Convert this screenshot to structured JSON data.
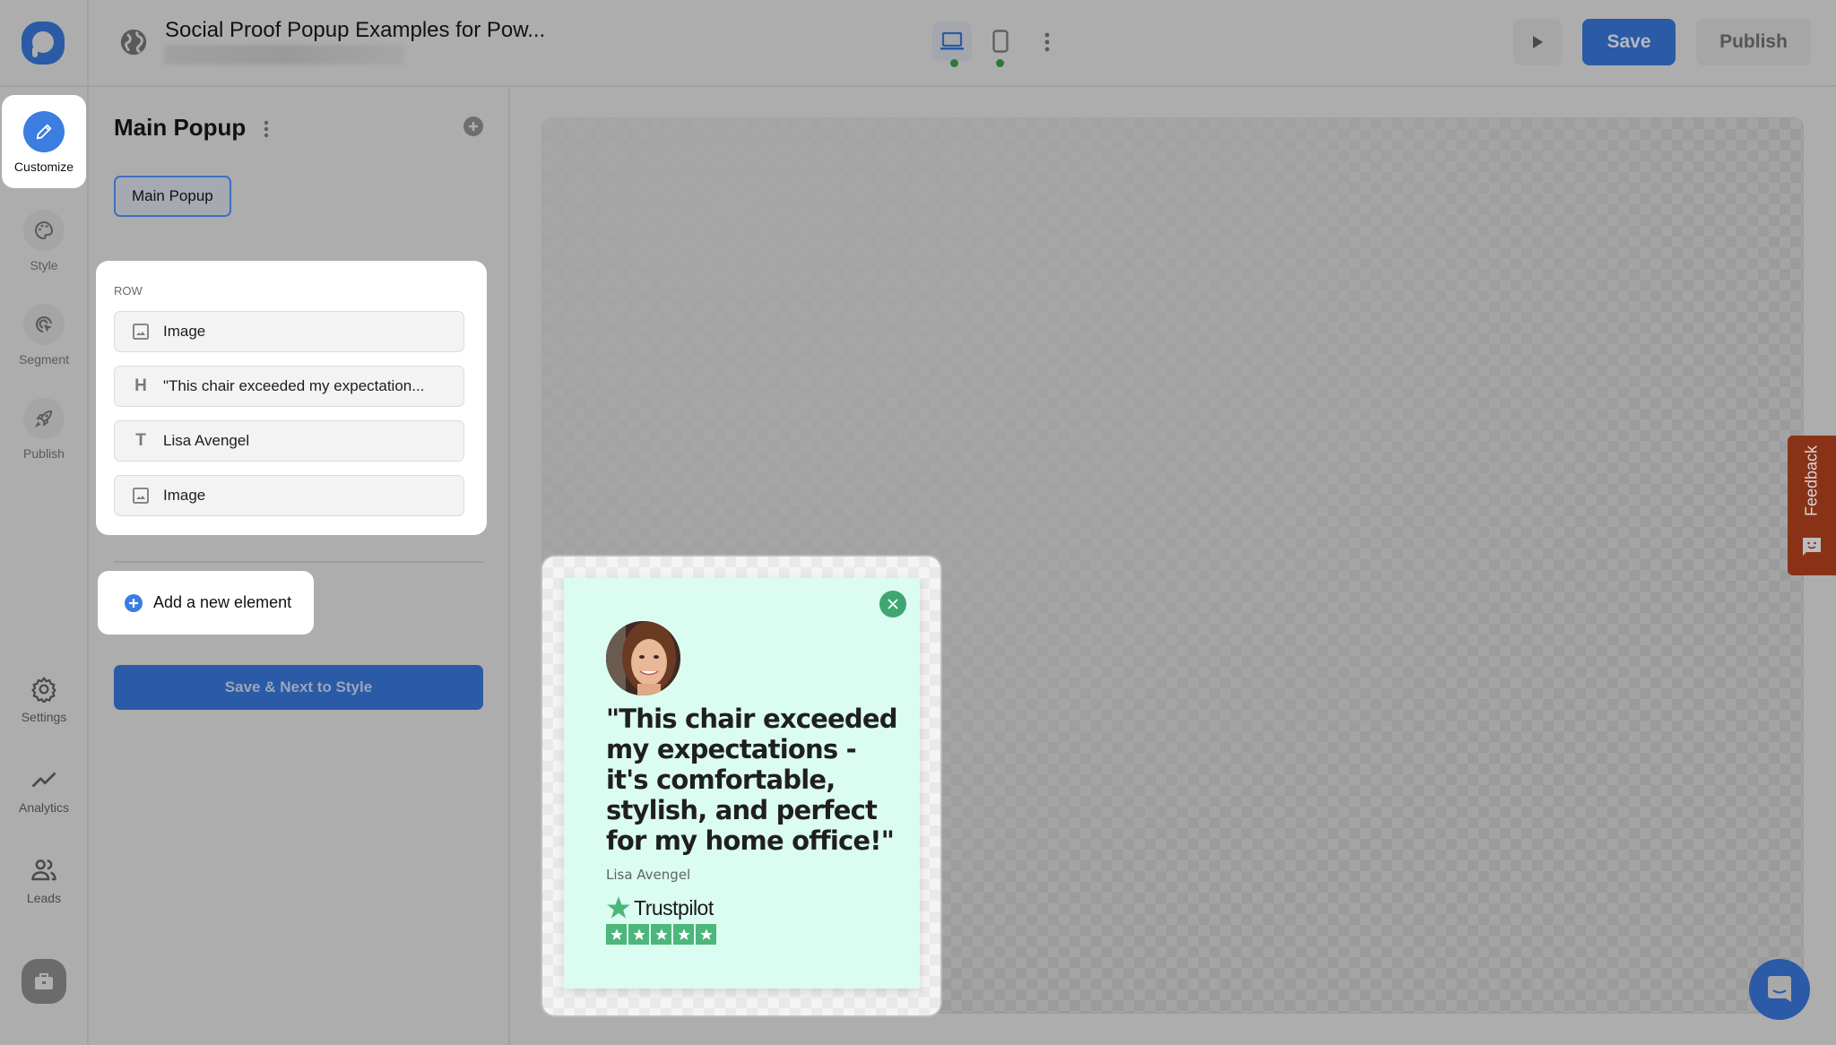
{
  "app": {
    "logo": "popupsmart-logo",
    "document_title": "Social Proof Popup Examples for Pow...",
    "document_subtitle_blurred": true
  },
  "topbar": {
    "globe_icon": "globe-icon",
    "devices": [
      {
        "name": "desktop",
        "icon": "laptop-icon",
        "active": true,
        "status_color": "#2c7a3a"
      },
      {
        "name": "mobile",
        "icon": "mobile-icon",
        "active": false,
        "status_color": "#2c7a3a"
      }
    ],
    "more_icon": "kebab-vertical-icon",
    "preview_icon": "play-icon",
    "save_label": "Save",
    "publish_label": "Publish"
  },
  "rail": {
    "items": [
      {
        "label": "Customize",
        "icon": "pencil-icon",
        "active": true
      },
      {
        "label": "Style",
        "icon": "palette-icon",
        "active": false
      },
      {
        "label": "Segment",
        "icon": "target-cursor-icon",
        "active": false
      },
      {
        "label": "Publish",
        "icon": "rocket-icon",
        "active": false
      }
    ],
    "bottom_items": [
      {
        "label": "Settings",
        "icon": "gear-icon"
      },
      {
        "label": "Analytics",
        "icon": "trend-line-icon"
      },
      {
        "label": "Leads",
        "icon": "users-icon"
      }
    ],
    "toolkit_icon": "briefcase-icon"
  },
  "panel": {
    "title": "Main Popup",
    "chip_label": "Main Popup",
    "row_label": "ROW",
    "elements": [
      {
        "type": "image",
        "icon": "image-icon",
        "label": "Image"
      },
      {
        "type": "heading",
        "icon": "H",
        "label": "\"This chair exceeded my expectation..."
      },
      {
        "type": "text",
        "icon": "T",
        "label": "Lisa Avengel"
      },
      {
        "type": "image",
        "icon": "image-icon",
        "label": "Image"
      }
    ],
    "add_element_label": "Add a new element",
    "next_button_label": "Save & Next to Style"
  },
  "popup": {
    "background": "#dbfcf1",
    "quote": "\"This chair exceeded my expectations - it's comfortable, stylish, and perfect for my home office!\"",
    "author": "Lisa Avengel",
    "rating_brand": "Trustpilot",
    "rating_stars": 5,
    "rating_max": 5,
    "accent": "#4cb67b"
  },
  "feedback_tab": {
    "label": "Feedback",
    "color": "#8a3218"
  },
  "chat_widget": {
    "icon": "chat-icon",
    "color": "#2b5aa6"
  }
}
